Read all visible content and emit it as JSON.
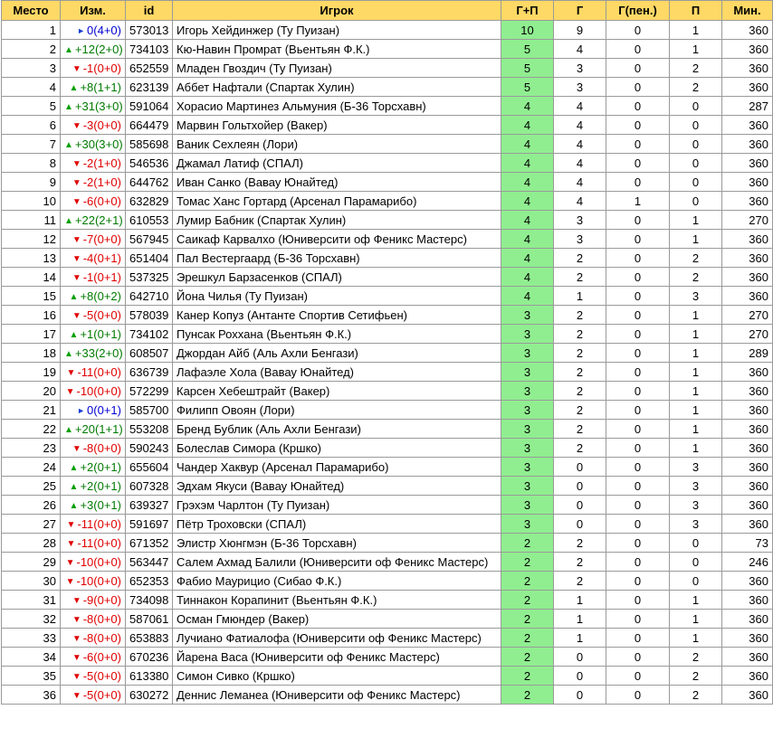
{
  "headers": {
    "place": "Место",
    "change": "Изм.",
    "id": "id",
    "player": "Игрок",
    "gp": "Г+П",
    "goals": "Г",
    "pen": "Г(пен.)",
    "assists": "П",
    "minutes": "Мин."
  },
  "colors": {
    "header_bg": "#ffd966",
    "gp_bg": "#90ee90",
    "up": "#00a000",
    "down": "#e00000",
    "same": "#1a3fd6"
  },
  "rows": [
    {
      "place": "1",
      "dir": "same",
      "change": "0(4+0)",
      "id": "573013",
      "player": "Игорь Хейдинжер (Ту Пуизан)",
      "gp": "10",
      "g": "9",
      "pen": "0",
      "a": "1",
      "min": "360"
    },
    {
      "place": "2",
      "dir": "up",
      "change": "+12(2+0)",
      "id": "734103",
      "player": "Кю-Навин Промрат (Вьентьян Ф.К.)",
      "gp": "5",
      "g": "4",
      "pen": "0",
      "a": "1",
      "min": "360"
    },
    {
      "place": "3",
      "dir": "down",
      "change": "-1(0+0)",
      "id": "652559",
      "player": "Младен Гвоздич (Ту Пуизан)",
      "gp": "5",
      "g": "3",
      "pen": "0",
      "a": "2",
      "min": "360"
    },
    {
      "place": "4",
      "dir": "up",
      "change": "+8(1+1)",
      "id": "623139",
      "player": "Аббет Нафтали (Спартак Хулин)",
      "gp": "5",
      "g": "3",
      "pen": "0",
      "a": "2",
      "min": "360"
    },
    {
      "place": "5",
      "dir": "up",
      "change": "+31(3+0)",
      "id": "591064",
      "player": "Хорасио Мартинез Альмуния (Б-36 Торсхавн)",
      "gp": "4",
      "g": "4",
      "pen": "0",
      "a": "0",
      "min": "287"
    },
    {
      "place": "6",
      "dir": "down",
      "change": "-3(0+0)",
      "id": "664479",
      "player": "Марвин Гольтхойер (Вакер)",
      "gp": "4",
      "g": "4",
      "pen": "0",
      "a": "0",
      "min": "360"
    },
    {
      "place": "7",
      "dir": "up",
      "change": "+30(3+0)",
      "id": "585698",
      "player": "Ваник Сехлеян (Лори)",
      "gp": "4",
      "g": "4",
      "pen": "0",
      "a": "0",
      "min": "360"
    },
    {
      "place": "8",
      "dir": "down",
      "change": "-2(1+0)",
      "id": "546536",
      "player": "Джамал Латиф (СПАЛ)",
      "gp": "4",
      "g": "4",
      "pen": "0",
      "a": "0",
      "min": "360"
    },
    {
      "place": "9",
      "dir": "down",
      "change": "-2(1+0)",
      "id": "644762",
      "player": "Иван Санко (Вавау Юнайтед)",
      "gp": "4",
      "g": "4",
      "pen": "0",
      "a": "0",
      "min": "360"
    },
    {
      "place": "10",
      "dir": "down",
      "change": "-6(0+0)",
      "id": "632829",
      "player": "Томас Ханс Гортард (Арсенал Парамарибо)",
      "gp": "4",
      "g": "4",
      "pen": "1",
      "a": "0",
      "min": "360"
    },
    {
      "place": "11",
      "dir": "up",
      "change": "+22(2+1)",
      "id": "610553",
      "player": "Лумир Бабник (Спартак Хулин)",
      "gp": "4",
      "g": "3",
      "pen": "0",
      "a": "1",
      "min": "270"
    },
    {
      "place": "12",
      "dir": "down",
      "change": "-7(0+0)",
      "id": "567945",
      "player": "Саикаф Карвалхо (Юниверсити оф Феникс Мастерс)",
      "gp": "4",
      "g": "3",
      "pen": "0",
      "a": "1",
      "min": "360"
    },
    {
      "place": "13",
      "dir": "down",
      "change": "-4(0+1)",
      "id": "651404",
      "player": "Пал Вестергаард (Б-36 Торсхавн)",
      "gp": "4",
      "g": "2",
      "pen": "0",
      "a": "2",
      "min": "360"
    },
    {
      "place": "14",
      "dir": "down",
      "change": "-1(0+1)",
      "id": "537325",
      "player": "Эрешкул Барзасенков (СПАЛ)",
      "gp": "4",
      "g": "2",
      "pen": "0",
      "a": "2",
      "min": "360"
    },
    {
      "place": "15",
      "dir": "up",
      "change": "+8(0+2)",
      "id": "642710",
      "player": "Йона Чилья (Ту Пуизан)",
      "gp": "4",
      "g": "1",
      "pen": "0",
      "a": "3",
      "min": "360"
    },
    {
      "place": "16",
      "dir": "down",
      "change": "-5(0+0)",
      "id": "578039",
      "player": "Канер Копуз (Антанте Спортив Сетифьен)",
      "gp": "3",
      "g": "2",
      "pen": "0",
      "a": "1",
      "min": "270"
    },
    {
      "place": "17",
      "dir": "up",
      "change": "+1(0+1)",
      "id": "734102",
      "player": "Пунсак Роххана (Вьентьян Ф.К.)",
      "gp": "3",
      "g": "2",
      "pen": "0",
      "a": "1",
      "min": "270"
    },
    {
      "place": "18",
      "dir": "up",
      "change": "+33(2+0)",
      "id": "608507",
      "player": "Джордан Айб (Аль Ахли Бенгази)",
      "gp": "3",
      "g": "2",
      "pen": "0",
      "a": "1",
      "min": "289"
    },
    {
      "place": "19",
      "dir": "down",
      "change": "-11(0+0)",
      "id": "636739",
      "player": "Лафаэле Хола (Вавау Юнайтед)",
      "gp": "3",
      "g": "2",
      "pen": "0",
      "a": "1",
      "min": "360"
    },
    {
      "place": "20",
      "dir": "down",
      "change": "-10(0+0)",
      "id": "572299",
      "player": "Карсен Хебештрайт (Вакер)",
      "gp": "3",
      "g": "2",
      "pen": "0",
      "a": "1",
      "min": "360"
    },
    {
      "place": "21",
      "dir": "same",
      "change": "0(0+1)",
      "id": "585700",
      "player": "Филипп Овоян (Лори)",
      "gp": "3",
      "g": "2",
      "pen": "0",
      "a": "1",
      "min": "360"
    },
    {
      "place": "22",
      "dir": "up",
      "change": "+20(1+1)",
      "id": "553208",
      "player": "Бренд Бублик (Аль Ахли Бенгази)",
      "gp": "3",
      "g": "2",
      "pen": "0",
      "a": "1",
      "min": "360"
    },
    {
      "place": "23",
      "dir": "down",
      "change": "-8(0+0)",
      "id": "590243",
      "player": "Болеслав Симора (Кршко)",
      "gp": "3",
      "g": "2",
      "pen": "0",
      "a": "1",
      "min": "360"
    },
    {
      "place": "24",
      "dir": "up",
      "change": "+2(0+1)",
      "id": "655604",
      "player": "Чандер Хаквур (Арсенал Парамарибо)",
      "gp": "3",
      "g": "0",
      "pen": "0",
      "a": "3",
      "min": "360"
    },
    {
      "place": "25",
      "dir": "up",
      "change": "+2(0+1)",
      "id": "607328",
      "player": "Эдхам Якуси (Вавау Юнайтед)",
      "gp": "3",
      "g": "0",
      "pen": "0",
      "a": "3",
      "min": "360"
    },
    {
      "place": "26",
      "dir": "up",
      "change": "+3(0+1)",
      "id": "639327",
      "player": "Грэхэм Чарлтон (Ту Пуизан)",
      "gp": "3",
      "g": "0",
      "pen": "0",
      "a": "3",
      "min": "360"
    },
    {
      "place": "27",
      "dir": "down",
      "change": "-11(0+0)",
      "id": "591697",
      "player": "Пётр Троховски (СПАЛ)",
      "gp": "3",
      "g": "0",
      "pen": "0",
      "a": "3",
      "min": "360"
    },
    {
      "place": "28",
      "dir": "down",
      "change": "-11(0+0)",
      "id": "671352",
      "player": "Элистр Хюнгмэн (Б-36 Торсхавн)",
      "gp": "2",
      "g": "2",
      "pen": "0",
      "a": "0",
      "min": "73"
    },
    {
      "place": "29",
      "dir": "down",
      "change": "-10(0+0)",
      "id": "563447",
      "player": "Салем Ахмад Балили (Юниверсити оф Феникс Мастерс)",
      "gp": "2",
      "g": "2",
      "pen": "0",
      "a": "0",
      "min": "246"
    },
    {
      "place": "30",
      "dir": "down",
      "change": "-10(0+0)",
      "id": "652353",
      "player": "Фабио Маурицио (Сибао Ф.К.)",
      "gp": "2",
      "g": "2",
      "pen": "0",
      "a": "0",
      "min": "360"
    },
    {
      "place": "31",
      "dir": "down",
      "change": "-9(0+0)",
      "id": "734098",
      "player": "Тиннакон Корапинит (Вьентьян Ф.К.)",
      "gp": "2",
      "g": "1",
      "pen": "0",
      "a": "1",
      "min": "360"
    },
    {
      "place": "32",
      "dir": "down",
      "change": "-8(0+0)",
      "id": "587061",
      "player": "Осман Гмюндер (Вакер)",
      "gp": "2",
      "g": "1",
      "pen": "0",
      "a": "1",
      "min": "360"
    },
    {
      "place": "33",
      "dir": "down",
      "change": "-8(0+0)",
      "id": "653883",
      "player": "Лучиано Фатиалофа (Юниверсити оф Феникс Мастерс)",
      "gp": "2",
      "g": "1",
      "pen": "0",
      "a": "1",
      "min": "360"
    },
    {
      "place": "34",
      "dir": "down",
      "change": "-6(0+0)",
      "id": "670236",
      "player": "Йарена Васа (Юниверсити оф Феникс Мастерс)",
      "gp": "2",
      "g": "0",
      "pen": "0",
      "a": "2",
      "min": "360"
    },
    {
      "place": "35",
      "dir": "down",
      "change": "-5(0+0)",
      "id": "613380",
      "player": "Симон Сивко (Кршко)",
      "gp": "2",
      "g": "0",
      "pen": "0",
      "a": "2",
      "min": "360"
    },
    {
      "place": "36",
      "dir": "down",
      "change": "-5(0+0)",
      "id": "630272",
      "player": "Деннис Леманеа (Юниверсити оф Феникс Мастерс)",
      "gp": "2",
      "g": "0",
      "pen": "0",
      "a": "2",
      "min": "360"
    }
  ]
}
